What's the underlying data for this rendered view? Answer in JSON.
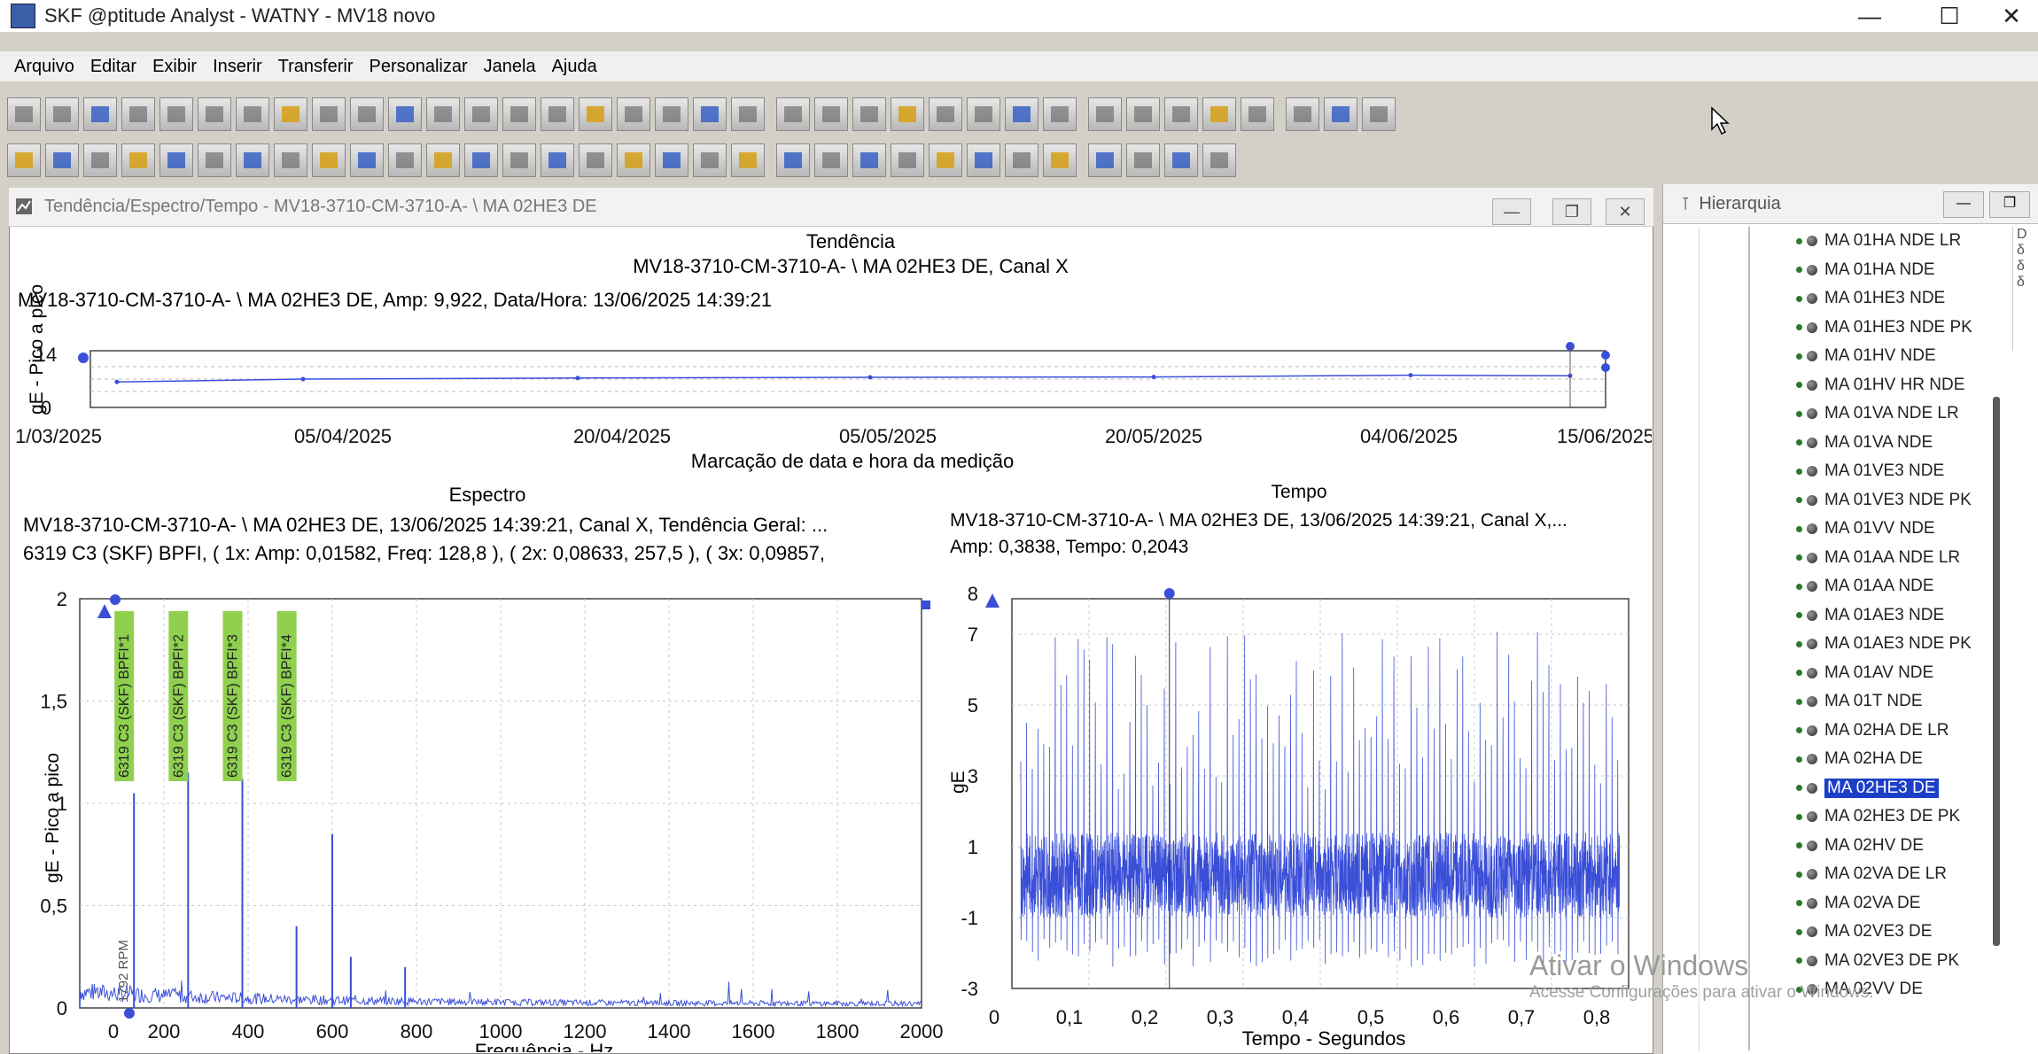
{
  "window": {
    "title": "SKF @ptitude Analyst - WATNY - MV18 novo",
    "min": "—",
    "max": "☐",
    "close": "✕"
  },
  "menu": [
    "Arquivo",
    "Editar",
    "Exibir",
    "Inserir",
    "Transferir",
    "Personalizar",
    "Janela",
    "Ajuda"
  ],
  "child_window": {
    "title": "Tendência/Espectro/Tempo - MV18-3710-CM-3710-A- \\ MA 02HE3 DE",
    "min": "—",
    "max": "❐",
    "close": "✕"
  },
  "trend": {
    "title": "Tendência",
    "subtitle": "MV18-3710-CM-3710-A- \\ MA 02HE3 DE, Canal X",
    "info": "MV18-3710-CM-3710-A- \\ MA 02HE3 DE, Amp: 9,922, Data/Hora: 13/06/2025 14:39:21",
    "ylabel": "gE - Pico a pico",
    "xlabel": "Marcação de data e hora da medição",
    "yticks": [
      "14",
      "0"
    ],
    "xticks": [
      "1/03/2025",
      "05/04/2025",
      "20/04/2025",
      "05/05/2025",
      "20/05/2025",
      "04/06/2025",
      "15/06/2025"
    ]
  },
  "spectrum": {
    "title": "Espectro",
    "line1": "MV18-3710-CM-3710-A- \\ MA 02HE3 DE, 13/06/2025 14:39:21, Canal X, Tendência Geral: ...",
    "line2": "6319 C3 (SKF) BPFI, ( 1x: Amp: 0,01582, Freq: 128,8 ), ( 2x: 0,08633, 257,5 ), ( 3x: 0,09857,",
    "ylabel": "gE - Pico a pico",
    "xlabel": "Frequência - Hz",
    "rpm_label": "1792 RPM",
    "fault_labels": [
      "6319 C3 (SKF) BPFI*1",
      "6319 C3 (SKF) BPFI*2",
      "6319 C3 (SKF) BPFI*3",
      "6319 C3 (SKF) BPFI*4"
    ],
    "yticks": [
      "2",
      "1,5",
      "1",
      "0,5",
      "0"
    ],
    "xticks": [
      "0",
      "200",
      "400",
      "600",
      "800",
      "1000",
      "1200",
      "1400",
      "1600",
      "1800",
      "2000"
    ]
  },
  "waveform": {
    "title": "Tempo",
    "line1": "MV18-3710-CM-3710-A- \\ MA 02HE3 DE, 13/06/2025 14:39:21, Canal X,...",
    "line2": "Amp: 0,3838, Tempo: 0,2043",
    "ylabel": "gE",
    "xlabel": "Tempo - Segundos",
    "yticks": [
      "8",
      "7",
      "5",
      "3",
      "1",
      "-1",
      "-3"
    ],
    "xticks": [
      "0",
      "0,1",
      "0,2",
      "0,3",
      "0,4",
      "0,5",
      "0,6",
      "0,7",
      "0,8"
    ]
  },
  "hierarchy": {
    "title": "Hierarquia",
    "items": [
      "MA 01HA NDE LR",
      "MA 01HA NDE",
      "MA 01HE3 NDE",
      "MA 01HE3 NDE PK",
      "MA 01HV NDE",
      "MA 01HV HR NDE",
      "MA 01VA NDE LR",
      "MA 01VA NDE",
      "MA 01VE3 NDE",
      "MA 01VE3 NDE PK",
      "MA 01VV NDE",
      "MA 01AA NDE LR",
      "MA 01AA NDE",
      "MA 01AE3 NDE",
      "MA 01AE3 NDE PK",
      "MA 01AV NDE",
      "MA 01T NDE",
      "MA 02HA DE LR",
      "MA 02HA DE",
      "MA 02HE3 DE",
      "MA 02HE3 DE PK",
      "MA 02HV DE",
      "MA 02VA DE LR",
      "MA 02VA DE",
      "MA 02VE3 DE",
      "MA 02VE3 DE PK",
      "MA 02VV DE"
    ],
    "selected": "MA 02HE3 DE"
  },
  "watermark": {
    "title": "Ativar o Windows",
    "sub": "Acesse Configurações para ativar o Windows."
  },
  "colors": {
    "trace": "#3a4fd8",
    "fault_label_bg": "#8fd14f",
    "selection": "#1c3fc8"
  },
  "chart_data": [
    {
      "type": "line",
      "title": "Tendência",
      "xlabel": "Marcação de data e hora da medição",
      "ylabel": "gE - Pico a pico",
      "ylim": [
        0,
        14
      ],
      "x": [
        "1/03/2025",
        "05/04/2025",
        "20/04/2025",
        "05/05/2025",
        "20/05/2025",
        "04/06/2025",
        "13/06/2025"
      ],
      "values": [
        8.2,
        9.0,
        9.3,
        9.5,
        9.6,
        10.1,
        9.922
      ]
    },
    {
      "type": "bar",
      "title": "Espectro",
      "xlabel": "Frequência - Hz",
      "ylabel": "gE - Pico a pico",
      "xlim": [
        0,
        2000
      ],
      "ylim": [
        0,
        2
      ],
      "x": [
        128.8,
        257.5,
        386.3,
        515.0,
        600,
        644,
        773
      ],
      "values": [
        1.05,
        1.15,
        1.12,
        0.4,
        0.85,
        0.25,
        0.2
      ]
    },
    {
      "type": "line",
      "title": "Tempo",
      "xlabel": "Tempo - Segundos",
      "ylabel": "gE",
      "xlim": [
        0,
        0.8
      ],
      "ylim": [
        -3,
        8
      ]
    }
  ]
}
